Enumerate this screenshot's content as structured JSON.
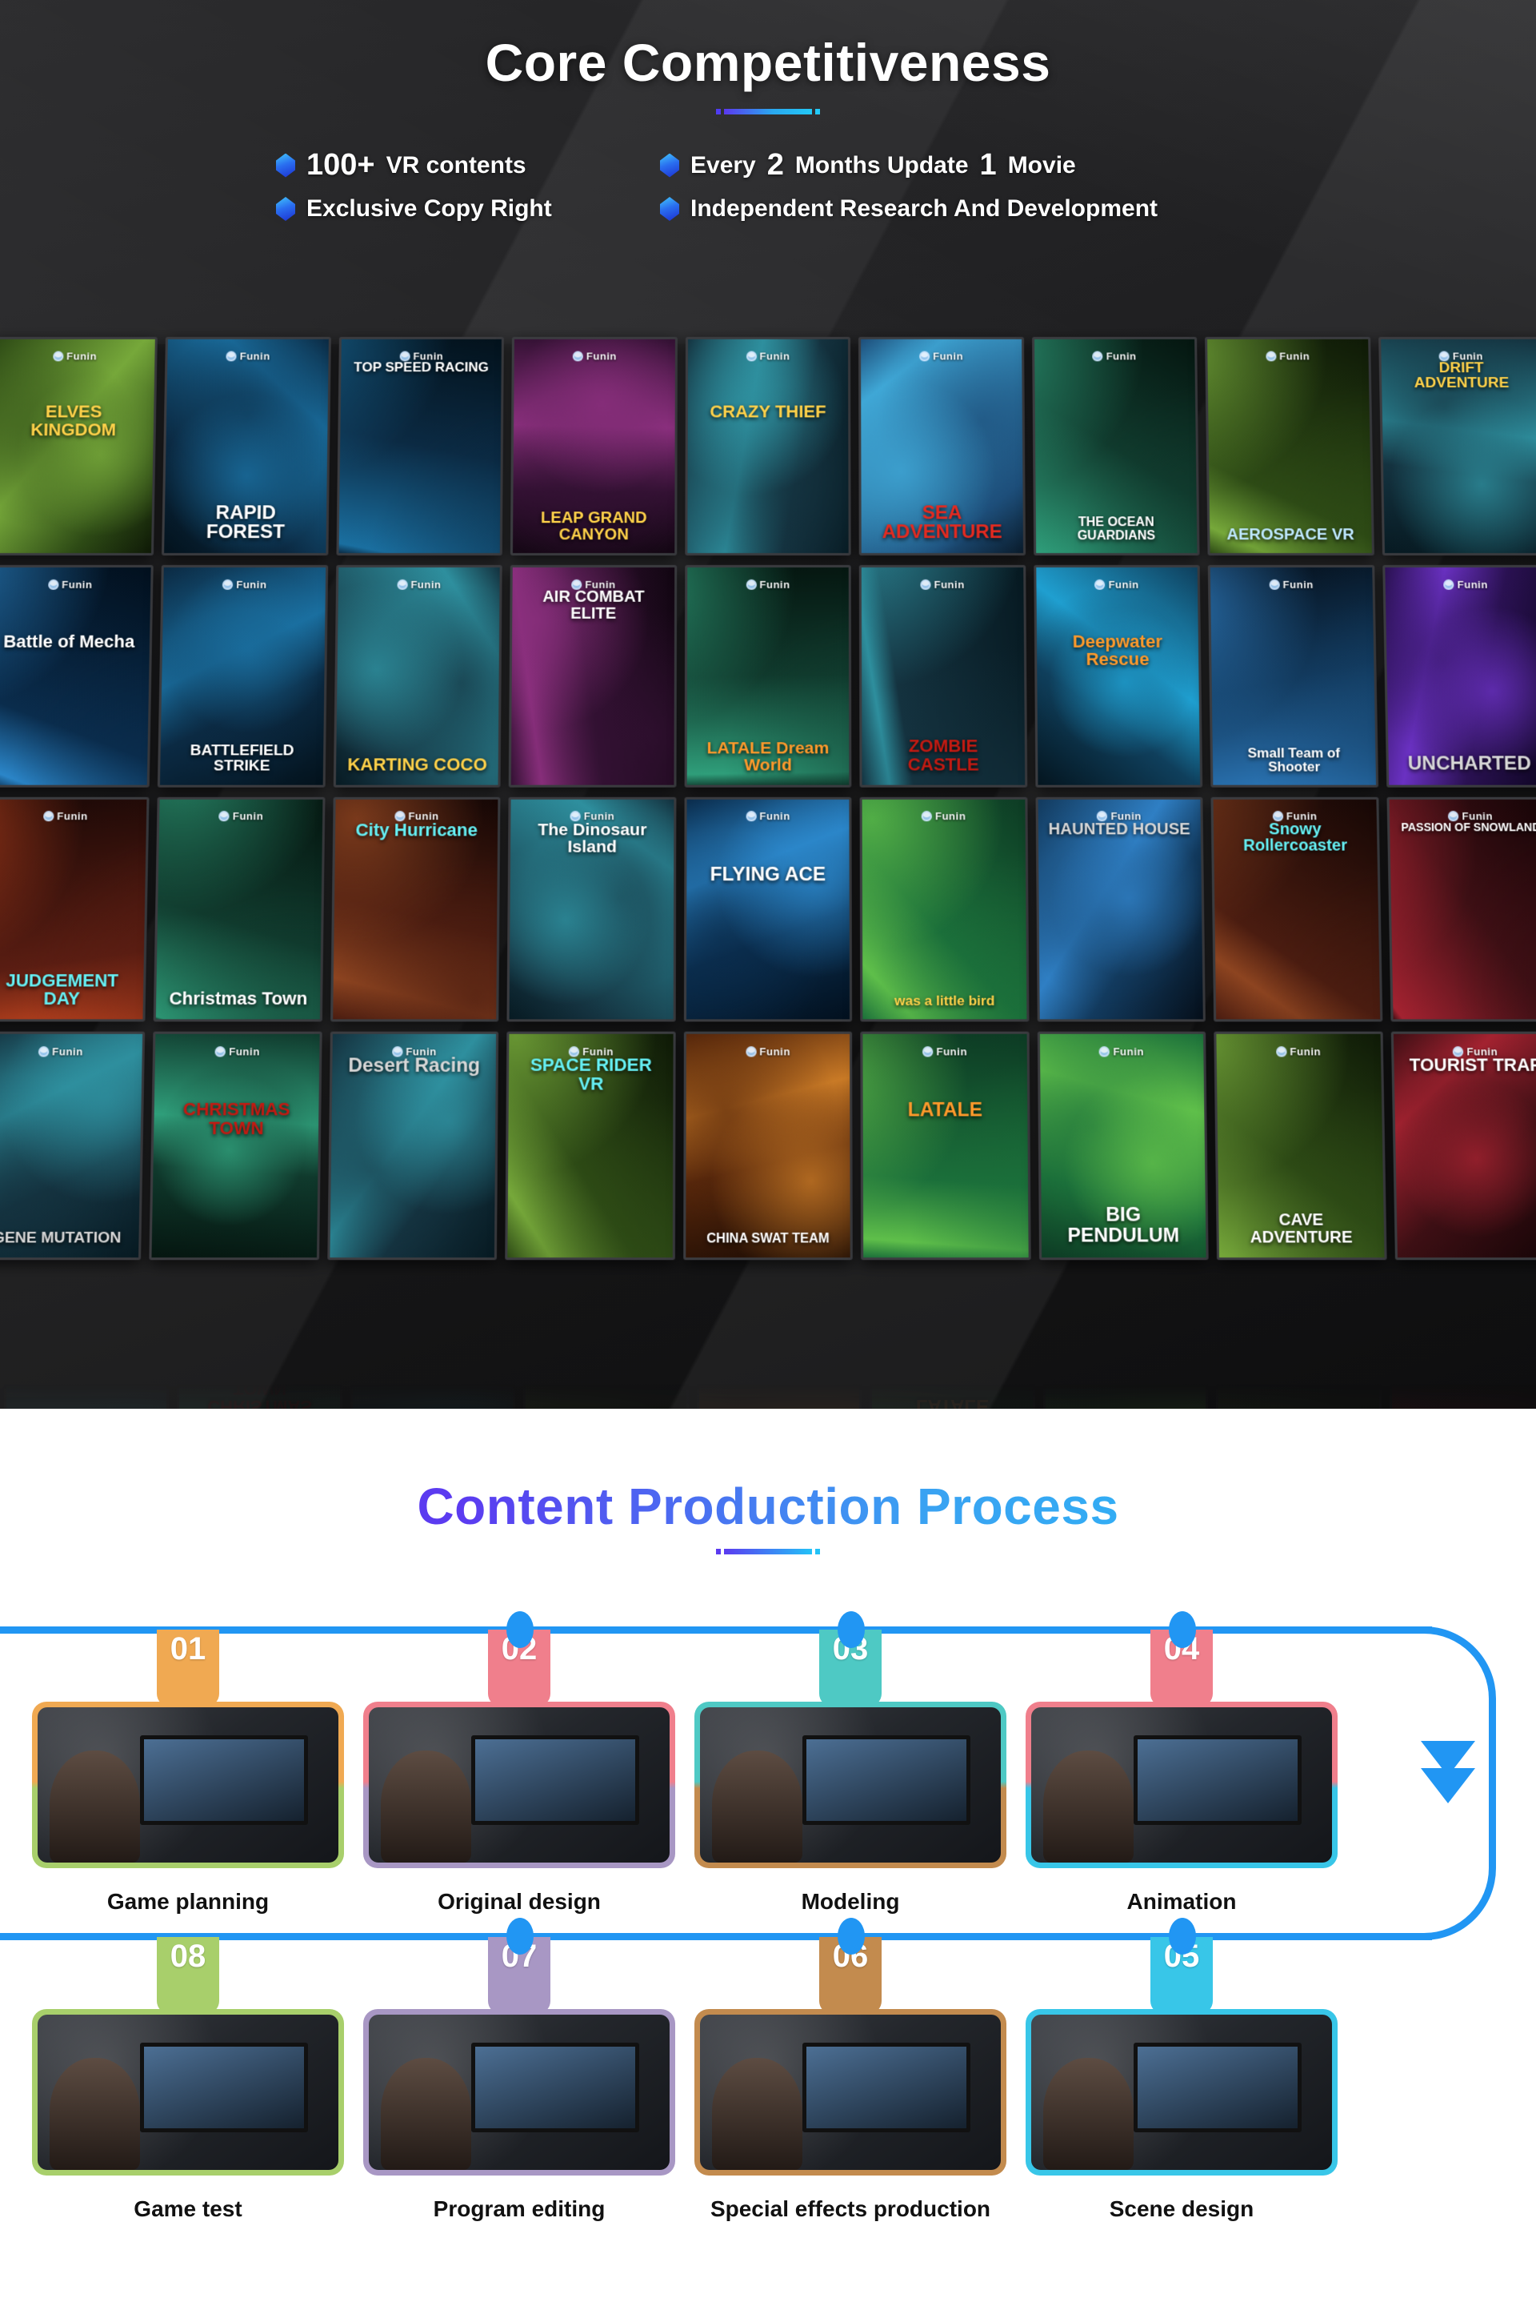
{
  "hero": {
    "title": "Core Competitiveness",
    "features": [
      {
        "highlight": "100+",
        "text": "VR contents",
        "bullet": "diamond-icon"
      },
      {
        "prefix": "Every",
        "highlight": "2",
        "mid": "Months Update",
        "highlight2": "1",
        "suffix": "Movie",
        "bullet": "diamond-icon"
      },
      {
        "text": "Exclusive Copy Right",
        "bullet": "diamond-icon"
      },
      {
        "text": "Independent Research And Development",
        "bullet": "diamond-icon"
      }
    ],
    "accent_start": "#5b39ef",
    "accent_end": "#23c9f7"
  },
  "poster_wall": {
    "brand": "Funin",
    "rows": [
      [
        {
          "title": "ELVES KINGDOM",
          "pos": "mid",
          "color": "c-gold",
          "size": 22
        },
        {
          "title": "RAPID FOREST",
          "pos": "bottom",
          "color": "c-white",
          "size": 24
        },
        {
          "title": "TOP SPEED RACING",
          "pos": "top",
          "color": "c-white",
          "size": 17
        },
        {
          "title": "LEAP GRAND CANYON",
          "pos": "bottom",
          "color": "c-gold",
          "size": 20
        },
        {
          "title": "CRAZY THIEF",
          "pos": "mid",
          "color": "c-gold",
          "size": 22
        },
        {
          "title": "SEA ADVENTURE",
          "pos": "bottom",
          "color": "c-red",
          "size": 24
        },
        {
          "title": "THE OCEAN GUARDIANS",
          "pos": "bottom",
          "color": "c-white",
          "size": 16
        },
        {
          "title": "AEROSPACE VR",
          "pos": "bottom",
          "color": "c-ltblue",
          "size": 20
        },
        {
          "title": "DRIFT ADVENTURE",
          "pos": "top",
          "color": "c-gold",
          "size": 19
        }
      ],
      [
        {
          "title": "Battle of Mecha",
          "pos": "mid",
          "color": "c-white",
          "size": 22
        },
        {
          "title": "BATTLEFIELD STRIKE",
          "pos": "bottom",
          "color": "c-white",
          "size": 19
        },
        {
          "title": "KARTING COCO",
          "pos": "bottom",
          "color": "c-gold",
          "size": 22
        },
        {
          "title": "AIR COMBAT ELITE",
          "pos": "top",
          "color": "c-white",
          "size": 20
        },
        {
          "title": "LATALE Dream World",
          "pos": "bottom",
          "color": "c-orange",
          "size": 21
        },
        {
          "title": "ZOMBIE CASTLE",
          "pos": "bottom",
          "color": "c-dkred",
          "size": 22
        },
        {
          "title": "Deepwater Rescue",
          "pos": "mid",
          "color": "c-orange",
          "size": 22
        },
        {
          "title": "Small Team of Shooter",
          "pos": "bottom",
          "color": "c-white",
          "size": 17
        },
        {
          "title": "UNCHARTED",
          "pos": "bottom",
          "color": "c-grey",
          "size": 24
        }
      ],
      [
        {
          "title": "JUDGEMENT DAY",
          "pos": "bottom",
          "color": "c-cyan",
          "size": 22
        },
        {
          "title": "Christmas Town",
          "pos": "bottom",
          "color": "c-white",
          "size": 22
        },
        {
          "title": "City Hurricane",
          "pos": "top",
          "color": "c-cyan",
          "size": 22
        },
        {
          "title": "The Dinosaur Island",
          "pos": "top",
          "color": "c-white",
          "size": 21
        },
        {
          "title": "FLYING ACE",
          "pos": "mid",
          "color": "c-white",
          "size": 24
        },
        {
          "title": "was a little bird",
          "pos": "bottom",
          "color": "c-gold",
          "size": 17
        },
        {
          "title": "HAUNTED HOUSE",
          "pos": "top",
          "color": "c-grey",
          "size": 20
        },
        {
          "title": "Snowy Rollercoaster",
          "pos": "top",
          "color": "c-cyan",
          "size": 20
        },
        {
          "title": "PASSION OF SNOWLAND",
          "pos": "top",
          "color": "c-white",
          "size": 14
        }
      ],
      [
        {
          "title": "GENE MUTATION",
          "pos": "bottom",
          "color": "c-grey",
          "size": 19
        },
        {
          "title": "CHRISTMAS TOWN",
          "pos": "mid",
          "color": "c-dkred",
          "size": 22
        },
        {
          "title": "Desert Racing",
          "pos": "top",
          "color": "c-grey",
          "size": 24
        },
        {
          "title": "SPACE RIDER VR",
          "pos": "top",
          "color": "c-cyan",
          "size": 22
        },
        {
          "title": "CHINA SWAT TEAM",
          "pos": "bottom",
          "color": "c-white",
          "size": 16
        },
        {
          "title": "LATALE",
          "pos": "mid",
          "color": "c-orange",
          "size": 24
        },
        {
          "title": "BIG PENDULUM",
          "pos": "bottom",
          "color": "c-white",
          "size": 24
        },
        {
          "title": "CAVE ADVENTURE",
          "pos": "bottom",
          "color": "c-white",
          "size": 20
        },
        {
          "title": "TOURIST TRAP",
          "pos": "top",
          "color": "c-white",
          "size": 22
        }
      ]
    ]
  },
  "process": {
    "title_part1": "Content ",
    "title_part2": " Production Process",
    "title": "Content  Production Process",
    "rail_color": "#2196f3",
    "steps_top": [
      {
        "number": "01",
        "label": "Game planning",
        "tab_color": "#f0a952",
        "card_top": "#f0a952",
        "card_bottom": "#a8cf6b"
      },
      {
        "number": "02",
        "label": "Original design",
        "tab_color": "#f07f8c",
        "card_top": "#f07f8c",
        "card_bottom": "#a897c4"
      },
      {
        "number": "03",
        "label": "Modeling",
        "tab_color": "#4ec9c4",
        "card_top": "#4ec9c4",
        "card_bottom": "#c38b4e"
      },
      {
        "number": "04",
        "label": "Animation",
        "tab_color": "#f07f8c",
        "card_top": "#f07f8c",
        "card_bottom": "#38c6e8"
      }
    ],
    "steps_bottom": [
      {
        "number": "08",
        "label": "Game test",
        "tab_color": "#a8cf6b",
        "card_top": "#a8cf6b",
        "card_bottom": "#a8cf6b"
      },
      {
        "number": "07",
        "label": "Program editing",
        "tab_color": "#a897c4",
        "card_top": "#a897c4",
        "card_bottom": "#a897c4"
      },
      {
        "number": "06",
        "label": "Special effects production",
        "tab_color": "#c38b4e",
        "card_top": "#c38b4e",
        "card_bottom": "#c38b4e"
      },
      {
        "number": "05",
        "label": "Scene design",
        "tab_color": "#38c6e8",
        "card_top": "#38c6e8",
        "card_bottom": "#38c6e8"
      }
    ]
  }
}
